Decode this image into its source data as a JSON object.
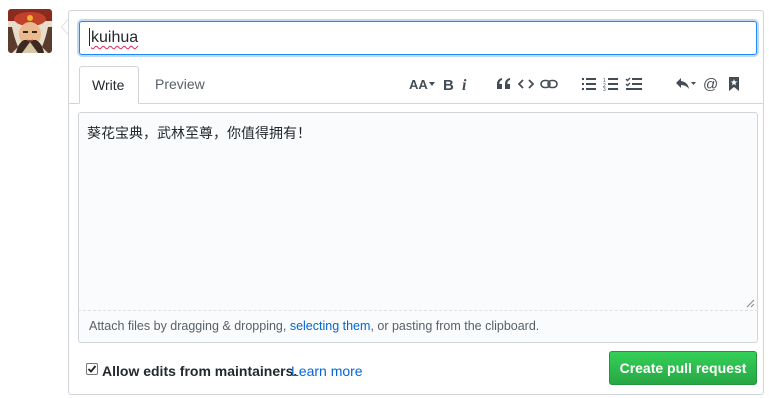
{
  "title_input": {
    "value": "kuihua"
  },
  "tabs": [
    {
      "label": "Write",
      "active": true
    },
    {
      "label": "Preview",
      "active": false
    }
  ],
  "toolbar": [
    {
      "icon": "text-size-icon"
    },
    {
      "icon": "bold-icon"
    },
    {
      "icon": "italic-icon"
    },
    {
      "icon": "quote-icon"
    },
    {
      "icon": "code-icon"
    },
    {
      "icon": "link-icon"
    },
    {
      "icon": "bullet-list-icon"
    },
    {
      "icon": "numbered-list-icon"
    },
    {
      "icon": "task-list-icon"
    },
    {
      "icon": "reply-icon"
    },
    {
      "icon": "mention-icon"
    },
    {
      "icon": "bookmark-icon"
    }
  ],
  "body_text": "葵花宝典，武林至尊，你值得拥有！",
  "attach": {
    "before": "Attach files by dragging & dropping, ",
    "link": "selecting them",
    "after": ", or pasting from the clipboard."
  },
  "allow_edits": {
    "checked": true,
    "label": "Allow edits from maintainers.",
    "learn_more": "Learn more"
  },
  "submit_button": "Create pull request",
  "colors": {
    "accent": "#0366d6",
    "button_green": "#28a745",
    "focus_border": "#2188ff"
  }
}
